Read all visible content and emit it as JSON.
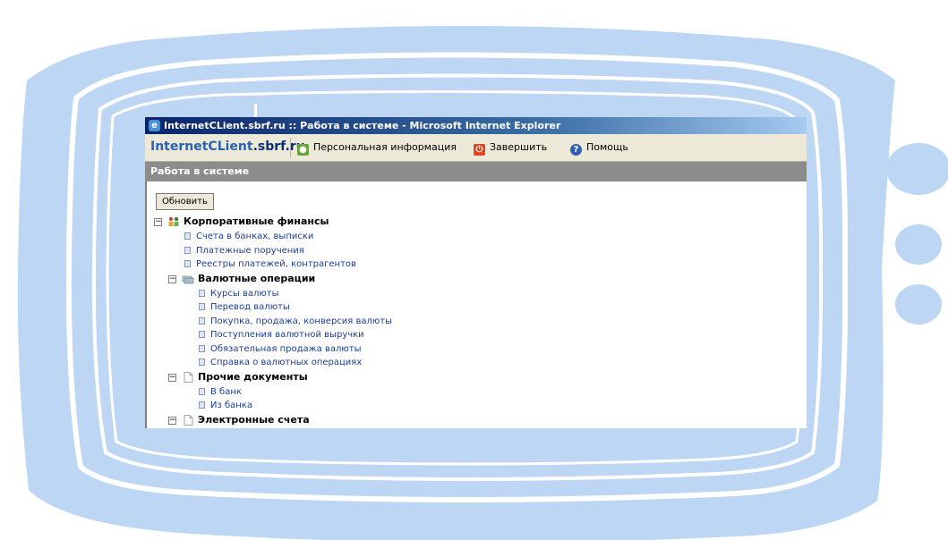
{
  "window": {
    "title": "InternetCLient.sbrf.ru :: Работа в системе - Microsoft Internet Explorer"
  },
  "toolbar": {
    "brand_part1": "InternetCLient",
    "brand_part2": ".sbrf.ru",
    "personal_info": "Персональная информация",
    "logout": "Завершить",
    "help": "Помощь"
  },
  "section": {
    "title": "Работа в системе"
  },
  "content": {
    "refresh_label": "Обновить",
    "tree": {
      "corp": "Корпоративные финансы",
      "corp_items": [
        "Счета в банках, выписки",
        "Платежные поручения",
        "Реестры платежей, контрагентов"
      ],
      "fx": "Валютные операции",
      "fx_items": [
        "Курсы валюты",
        "Перевод валюты",
        "Покупка, продажа, конверсия валюты",
        "Поступления валютной выручки",
        "Обязательная продажа валюты",
        "Справка о валютных операциях"
      ],
      "other": "Прочие документы",
      "other_items": [
        "В банк",
        "Из банка"
      ],
      "eacc": "Электронные счета"
    }
  },
  "colors": {
    "frame": "#bcd6f4",
    "brand": "#2b62b8",
    "link": "#1a3d9a",
    "section_bar": "#8c8c8c"
  }
}
